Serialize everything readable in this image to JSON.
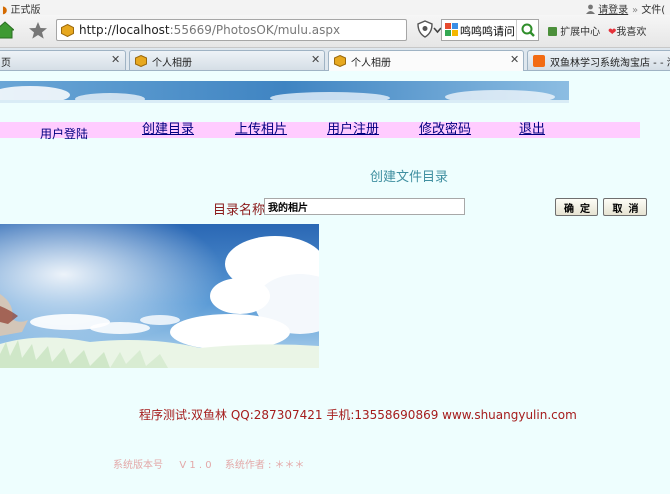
{
  "browser": {
    "edition": "正式版",
    "login": "请登录",
    "file_menu": "文件(",
    "address": {
      "host": "http://localhost",
      "rest": ":55669/PhotosOK/mulu.aspx"
    },
    "search_text": "鸣鸣鸣请问",
    "extensions": "扩展中心",
    "favorites": "我喜欢"
  },
  "tabs": [
    {
      "label": "页"
    },
    {
      "label": "个人相册"
    },
    {
      "label": "个人相册",
      "active": true
    },
    {
      "label": "双鱼林学习系统淘宝店 - - 淘宝"
    }
  ],
  "menu": {
    "user": "用户登陆",
    "create": "创建目录",
    "upload": "上传相片",
    "register": "用户注册",
    "password": "修改密码",
    "exit": "退出"
  },
  "form": {
    "title": "创建文件目录",
    "label": "目录名称",
    "value": "我的相片",
    "ok": "确定",
    "cancel": "取消"
  },
  "footer": {
    "credit": "程序测试:双鱼林 QQ:287307421 手机:13558690869 www.shuangyulin.com",
    "version": "系统版本号 　 V 1 . 0 　系统作者 : ＊＊＊"
  },
  "colors": {
    "page_bg": "#eefefe",
    "menu_bg": "#ffccff",
    "link": "#000080",
    "form_title": "#3f8fa0",
    "label": "#8b1a1a",
    "footer": "#a51c1c"
  }
}
